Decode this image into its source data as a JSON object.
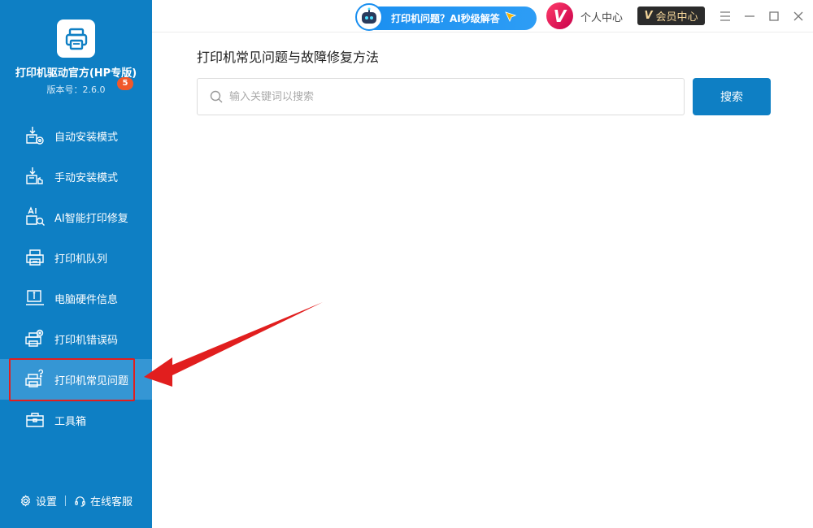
{
  "app": {
    "title": "打印机驱动官方(HP专版)",
    "version": "版本号：2.6.0"
  },
  "sidebar": {
    "items": [
      {
        "label": "自动安装模式",
        "icon": "auto-install-icon"
      },
      {
        "label": "手动安装模式",
        "icon": "manual-install-icon"
      },
      {
        "label": "AI智能打印修复",
        "icon": "ai-repair-icon",
        "badge": "5"
      },
      {
        "label": "打印机队列",
        "icon": "printer-queue-icon"
      },
      {
        "label": "电脑硬件信息",
        "icon": "hardware-info-icon"
      },
      {
        "label": "打印机错误码",
        "icon": "printer-error-icon"
      },
      {
        "label": "打印机常见问题",
        "icon": "printer-faq-icon",
        "active": true
      },
      {
        "label": "工具箱",
        "icon": "toolbox-icon"
      }
    ],
    "footer": {
      "settings": "设置",
      "service": "在线客服"
    }
  },
  "topbar": {
    "ai_pill": "打印机问题？AI秒级解答",
    "vip_letter": "V",
    "personal": "个人中心",
    "member_letter": "V",
    "member": "会员中心"
  },
  "main": {
    "title": "打印机常见问题与故障修复方法",
    "search_placeholder": "输入关键词以搜索",
    "search_button": "搜索"
  },
  "colors": {
    "sidebar": "#0e7fc4",
    "active_item": "#3596d4",
    "accent": "#0e7fc4",
    "badge": "#f0582b",
    "annotation": "#e11e1e"
  }
}
